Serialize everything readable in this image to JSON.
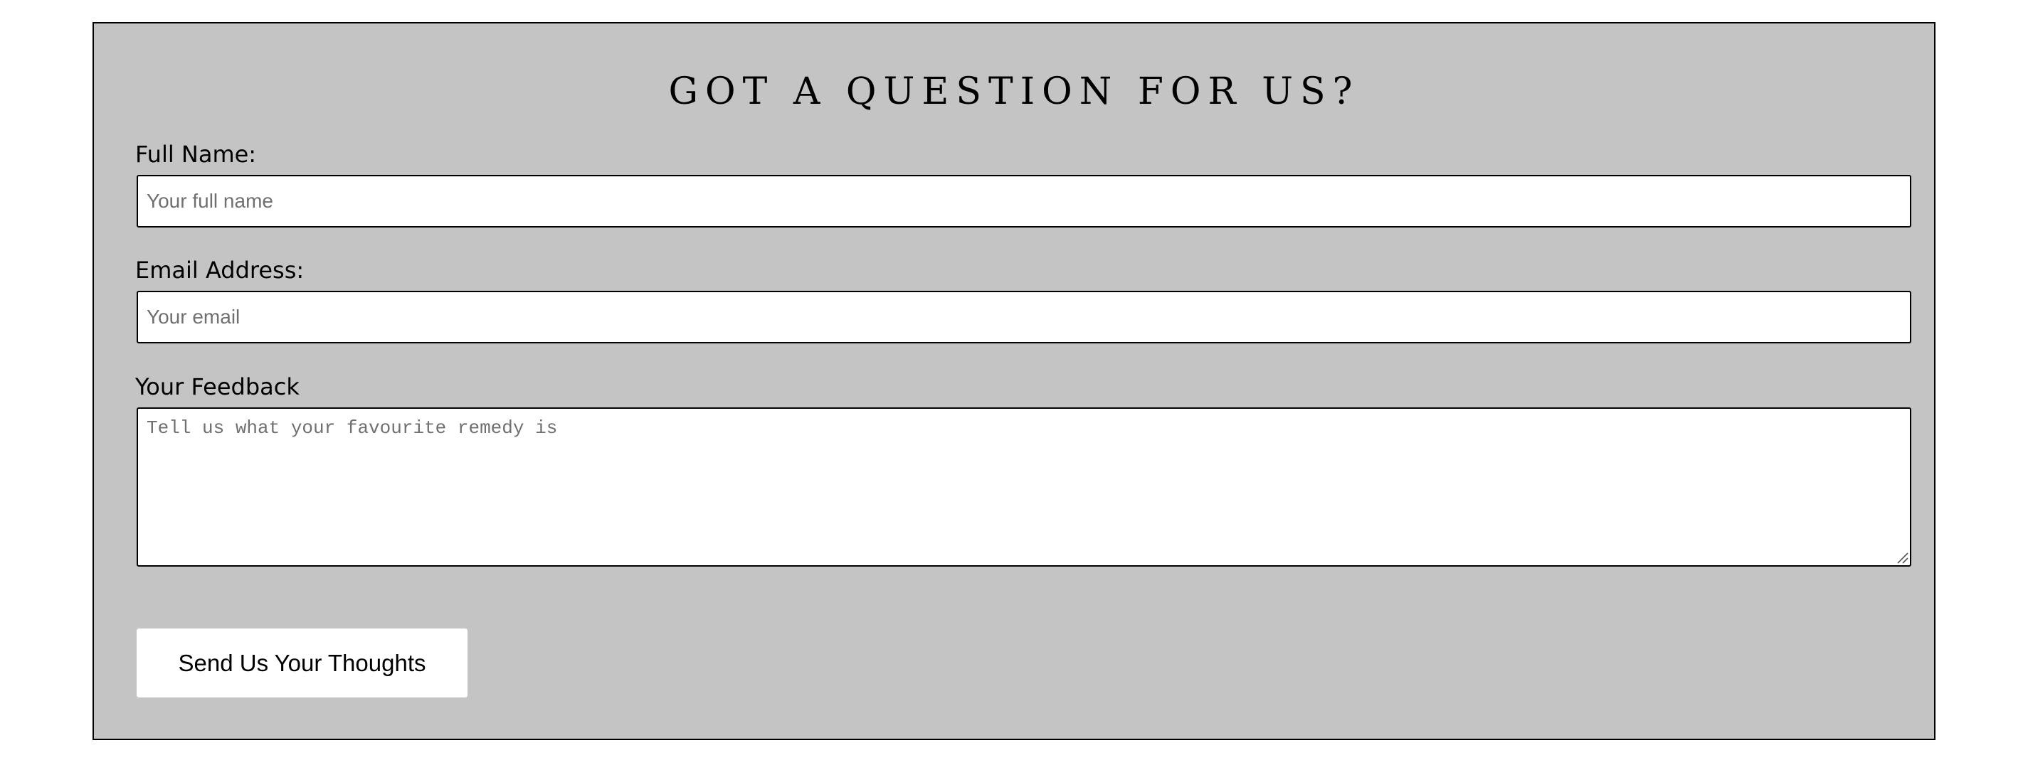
{
  "form": {
    "title": "GOT A QUESTION FOR US?",
    "name": {
      "label": "Full Name:",
      "value": "",
      "placeholder": "Your full name"
    },
    "email": {
      "label": "Email Address:",
      "value": "",
      "placeholder": "Your email"
    },
    "feedback": {
      "label": "Your Feedback",
      "value": "",
      "placeholder": "Tell us what your favourite remedy is"
    },
    "submit_label": "Send Us Your Thoughts"
  },
  "colors": {
    "panel_background": "#c3c4c3",
    "panel_border": "#000000",
    "field_background": "#ffffff",
    "placeholder_text": "#707070",
    "button_background": "#ffffff"
  },
  "icons": {
    "textarea_resize": "resize-grip-icon"
  }
}
